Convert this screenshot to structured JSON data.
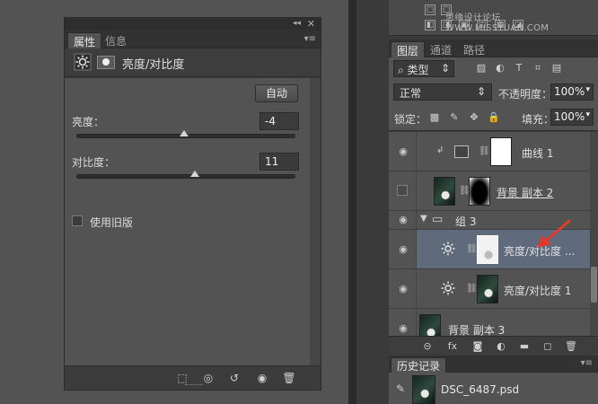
{
  "colors": {
    "background": "#535353",
    "panel_dark": "#3b3b3b",
    "selection": "#5f6b7c",
    "annotation_arrow": "#e03a2f"
  },
  "properties_panel": {
    "collapse_icon": "double-chevron-icon",
    "close_icon": "close-icon",
    "tabs": [
      "属性",
      "信息"
    ],
    "header_title": "亮度/对比度",
    "auto_button": "自动",
    "brightness": {
      "label": "亮度：",
      "value": "-4",
      "slider_fraction": 0.49
    },
    "contrast": {
      "label": "对比度：",
      "value": "11",
      "slider_fraction": 0.54
    },
    "use_legacy": {
      "label": "使用旧版",
      "checked": false
    },
    "footer_icons": [
      "clip-to-layer-icon",
      "visibility-toggle-icon",
      "reset-icon",
      "eye-icon",
      "trash-icon"
    ]
  },
  "top_toolbar": {
    "watermark": "思缘设计论坛 WWW.MISSYUAN.COM"
  },
  "layers_panel": {
    "tabs": [
      "图层",
      "通道",
      "路径"
    ],
    "filter_select": "类型",
    "blend_mode": "正常",
    "opacity_label": "不透明度：",
    "opacity_value": "100%",
    "lock_label": "锁定：",
    "fill_label": "填充：",
    "fill_value": "100%",
    "layers": [
      {
        "name": "曲线 1",
        "type": "curves",
        "visible": true,
        "clipped": true
      },
      {
        "name": "背景 副本 2",
        "type": "image-with-mask",
        "visible": false
      },
      {
        "name": "组 3",
        "type": "group",
        "visible": true,
        "expanded": true
      },
      {
        "name": "亮度/对比度 ...",
        "type": "brightness-contrast",
        "visible": true,
        "selected": true
      },
      {
        "name": "亮度/对比度 1",
        "type": "brightness-contrast",
        "visible": true
      },
      {
        "name": "背景 副本 3",
        "type": "image",
        "visible": true
      }
    ]
  },
  "history_panel": {
    "tab": "历史记录",
    "item": "DSC_6487.psd"
  }
}
